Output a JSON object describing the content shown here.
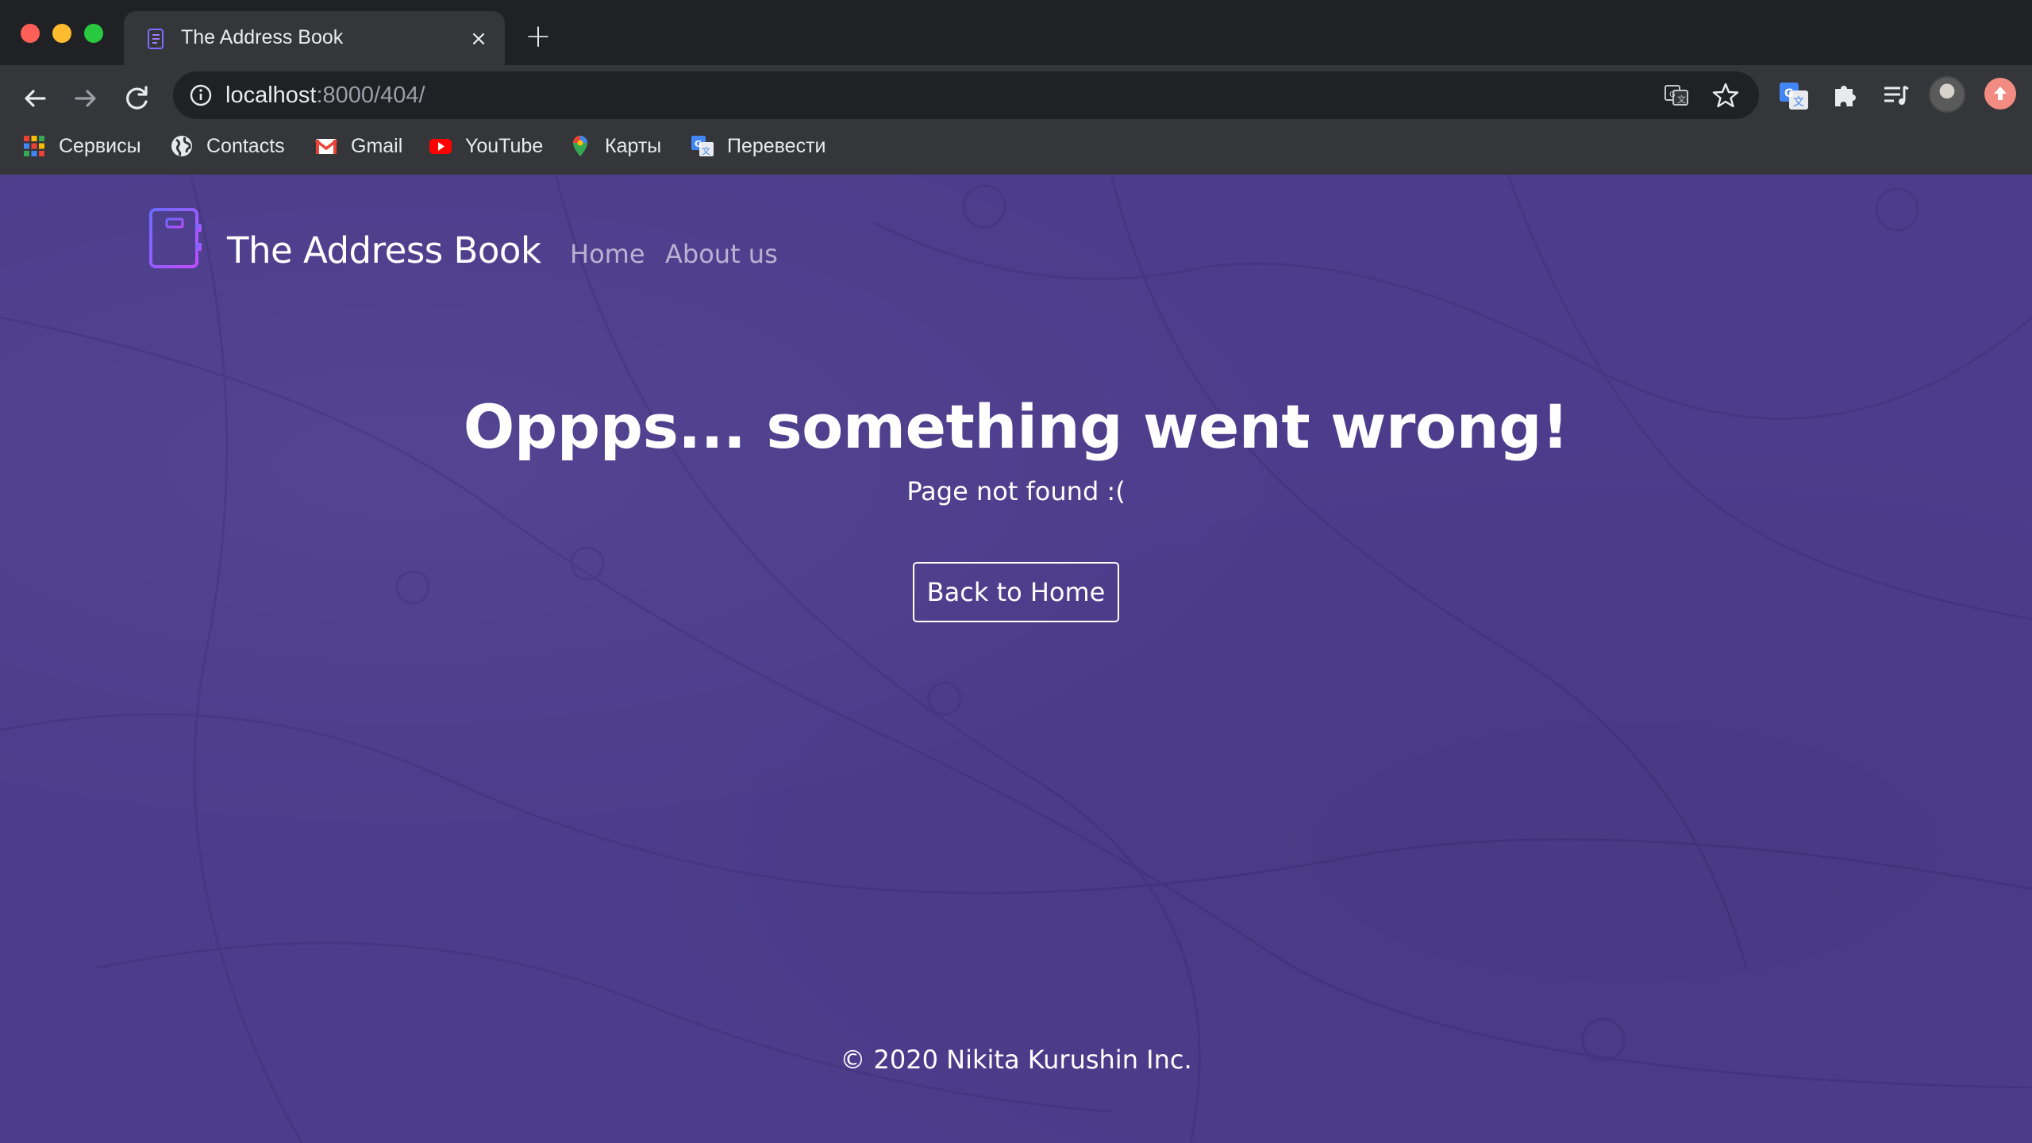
{
  "browser": {
    "tab": {
      "title": "The Address Book",
      "close_glyph": "×",
      "favicon": "notebook-icon"
    },
    "new_tab_glyph": "+",
    "address_bar": {
      "host": "localhost",
      "path": ":8000/404/"
    },
    "bookmarks": [
      {
        "label": "Сервисы",
        "icon": "apps-grid-icon"
      },
      {
        "label": "Contacts",
        "icon": "globe-icon"
      },
      {
        "label": "Gmail",
        "icon": "gmail-icon"
      },
      {
        "label": "YouTube",
        "icon": "youtube-icon"
      },
      {
        "label": "Карты",
        "icon": "maps-pin-icon"
      },
      {
        "label": "Перевести",
        "icon": "translate-icon"
      }
    ],
    "colors": {
      "chrome_dark": "#202124",
      "toolbar": "#35363a",
      "text": "#e8eaed"
    }
  },
  "site": {
    "brand": "The Address Book",
    "nav": {
      "home": "Home",
      "about": "About us"
    },
    "error": {
      "headline": "Oppps... something went wrong!",
      "message": "Page not found :(",
      "button": "Back to Home"
    },
    "footer": "© 2020 Nikita Kurushin Inc.",
    "colors": {
      "background": "#4c3d8c",
      "text": "#ffffff",
      "logo_gradient": [
        "#7b5cff",
        "#c04dff"
      ]
    }
  }
}
